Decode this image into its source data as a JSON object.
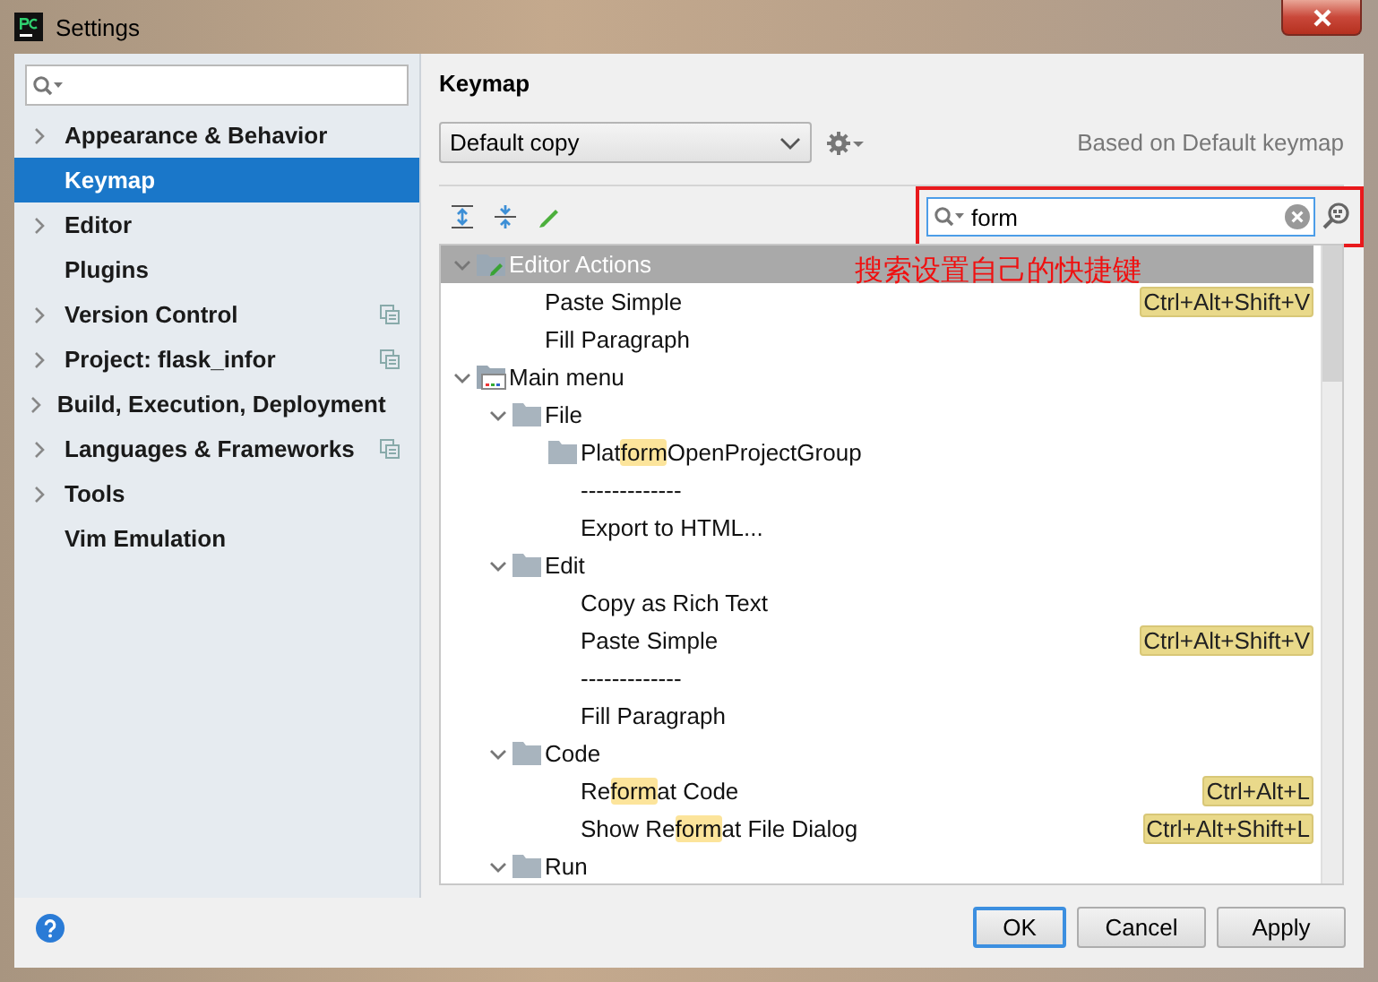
{
  "window": {
    "title": "Settings"
  },
  "sidebar": {
    "items": [
      {
        "label": "Appearance & Behavior",
        "expanded": false,
        "selected": false,
        "project_scoped": false
      },
      {
        "label": "Keymap",
        "selected": true,
        "project_scoped": false
      },
      {
        "label": "Editor",
        "expanded": false,
        "selected": false,
        "project_scoped": false
      },
      {
        "label": "Plugins",
        "selected": false,
        "project_scoped": false
      },
      {
        "label": "Version Control",
        "expanded": false,
        "selected": false,
        "project_scoped": true
      },
      {
        "label": "Project: flask_infor",
        "expanded": false,
        "selected": false,
        "project_scoped": true
      },
      {
        "label": "Build, Execution, Deployment",
        "expanded": false,
        "selected": false,
        "project_scoped": false
      },
      {
        "label": "Languages & Frameworks",
        "expanded": false,
        "selected": false,
        "project_scoped": true
      },
      {
        "label": "Tools",
        "expanded": false,
        "selected": false,
        "project_scoped": false
      },
      {
        "label": "Vim Emulation",
        "selected": false,
        "project_scoped": false
      }
    ]
  },
  "keymap": {
    "title": "Keymap",
    "scheme": "Default copy",
    "based_on": "Based on Default keymap",
    "search": {
      "value": "form"
    },
    "annotation": "搜索设置自己的快捷键",
    "tree": [
      {
        "kind": "editor-actions",
        "parts": [
          {
            "text": "Editor Actions",
            "match": false
          }
        ],
        "expanded": true,
        "selected": true,
        "children": [
          {
            "kind": "action",
            "parts": [
              {
                "text": "Paste Simple",
                "match": false
              }
            ],
            "shortcut": "Ctrl+Alt+Shift+V",
            "selected": false
          },
          {
            "kind": "action",
            "parts": [
              {
                "text": "Fill Paragraph",
                "match": false
              }
            ],
            "selected": false
          }
        ]
      },
      {
        "kind": "main-menu",
        "parts": [
          {
            "text": "Main menu",
            "match": false
          }
        ],
        "expanded": true,
        "selected": false,
        "children": [
          {
            "kind": "folder",
            "parts": [
              {
                "text": "File",
                "match": false
              }
            ],
            "expanded": true,
            "selected": false,
            "children": [
              {
                "kind": "folder",
                "parts": [
                  {
                    "text": "Plat",
                    "match": false
                  },
                  {
                    "text": "form",
                    "match": true
                  },
                  {
                    "text": "OpenProjectGroup",
                    "match": false
                  }
                ],
                "selected": false
              },
              {
                "kind": "separator",
                "parts": [
                  {
                    "text": "-------------",
                    "match": false
                  }
                ],
                "selected": false
              },
              {
                "kind": "action",
                "parts": [
                  {
                    "text": "Export to HTML...",
                    "match": false
                  }
                ],
                "selected": false
              }
            ]
          },
          {
            "kind": "folder",
            "parts": [
              {
                "text": "Edit",
                "match": false
              }
            ],
            "expanded": true,
            "selected": false,
            "children": [
              {
                "kind": "action",
                "parts": [
                  {
                    "text": "Copy as Rich Text",
                    "match": false
                  }
                ],
                "selected": false
              },
              {
                "kind": "action",
                "parts": [
                  {
                    "text": "Paste Simple",
                    "match": false
                  }
                ],
                "shortcut": "Ctrl+Alt+Shift+V",
                "selected": false
              },
              {
                "kind": "separator",
                "parts": [
                  {
                    "text": "-------------",
                    "match": false
                  }
                ],
                "selected": false
              },
              {
                "kind": "action",
                "parts": [
                  {
                    "text": "Fill Paragraph",
                    "match": false
                  }
                ],
                "selected": false
              }
            ]
          },
          {
            "kind": "folder",
            "parts": [
              {
                "text": "Code",
                "match": false
              }
            ],
            "expanded": true,
            "selected": false,
            "children": [
              {
                "kind": "action",
                "parts": [
                  {
                    "text": "Re",
                    "match": false
                  },
                  {
                    "text": "form",
                    "match": true
                  },
                  {
                    "text": "at Code",
                    "match": false
                  }
                ],
                "shortcut": "Ctrl+Alt+L",
                "selected": false
              },
              {
                "kind": "action",
                "parts": [
                  {
                    "text": "Show Re",
                    "match": false
                  },
                  {
                    "text": "form",
                    "match": true
                  },
                  {
                    "text": "at File Dialog",
                    "match": false
                  }
                ],
                "shortcut": "Ctrl+Alt+Shift+L",
                "selected": false
              }
            ]
          },
          {
            "kind": "folder",
            "parts": [
              {
                "text": "Run",
                "match": false
              }
            ],
            "expanded": true,
            "selected": false
          }
        ]
      }
    ]
  },
  "buttons": [
    {
      "label": "OK",
      "default": true
    },
    {
      "label": "Cancel",
      "default": false
    },
    {
      "label": "Apply",
      "default": false
    }
  ]
}
